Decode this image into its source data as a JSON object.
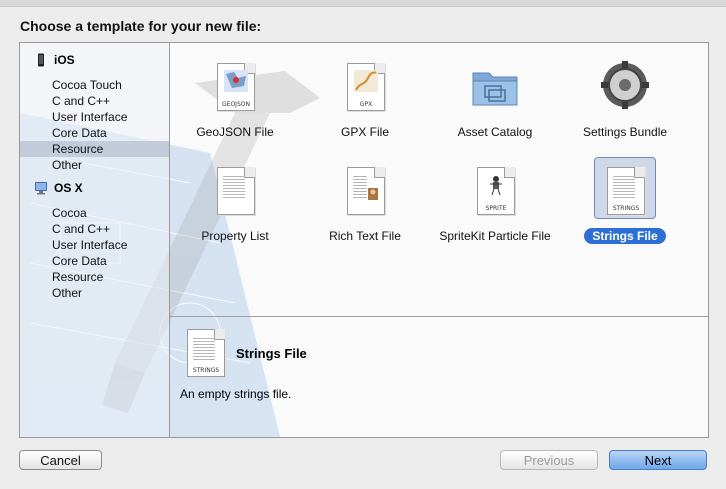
{
  "dialog": {
    "title": "Choose a template for your new file:"
  },
  "sidebar": {
    "sections": [
      {
        "label": "iOS",
        "icon": "iphone-icon",
        "items": [
          {
            "label": "Cocoa Touch",
            "selected": false
          },
          {
            "label": "C and C++",
            "selected": false
          },
          {
            "label": "User Interface",
            "selected": false
          },
          {
            "label": "Core Data",
            "selected": false
          },
          {
            "label": "Resource",
            "selected": true
          },
          {
            "label": "Other",
            "selected": false
          }
        ]
      },
      {
        "label": "OS X",
        "icon": "mac-icon",
        "items": [
          {
            "label": "Cocoa",
            "selected": false
          },
          {
            "label": "C and C++",
            "selected": false
          },
          {
            "label": "User Interface",
            "selected": false
          },
          {
            "label": "Core Data",
            "selected": false
          },
          {
            "label": "Resource",
            "selected": false
          },
          {
            "label": "Other",
            "selected": false
          }
        ]
      }
    ]
  },
  "templates": [
    {
      "label": "GeoJSON File",
      "icon": "geojson-file-icon",
      "tag": "GEOJSON",
      "selected": false
    },
    {
      "label": "GPX File",
      "icon": "gpx-file-icon",
      "tag": "GPX",
      "selected": false
    },
    {
      "label": "Asset Catalog",
      "icon": "folder-icon",
      "tag": "",
      "selected": false
    },
    {
      "label": "Settings Bundle",
      "icon": "gear-icon",
      "tag": "",
      "selected": false
    },
    {
      "label": "Property List",
      "icon": "property-list-icon",
      "tag": "",
      "selected": false
    },
    {
      "label": "Rich Text File",
      "icon": "rich-text-file-icon",
      "tag": "",
      "selected": false
    },
    {
      "label": "SpriteKit Particle File",
      "icon": "sprite-file-icon",
      "tag": "SPRITE",
      "selected": false
    },
    {
      "label": "Strings File",
      "icon": "strings-file-icon",
      "tag": "STRINGS",
      "selected": true
    }
  ],
  "detail": {
    "title": "Strings File",
    "description": "An empty strings file.",
    "icon_tag": "STRINGS"
  },
  "buttons": {
    "cancel": "Cancel",
    "previous": "Previous",
    "next": "Next"
  },
  "colors": {
    "selection_blue": "#2e6fd6",
    "sidebar_selected": "#c2cbd9",
    "blueprint": "#8fb6e6"
  }
}
